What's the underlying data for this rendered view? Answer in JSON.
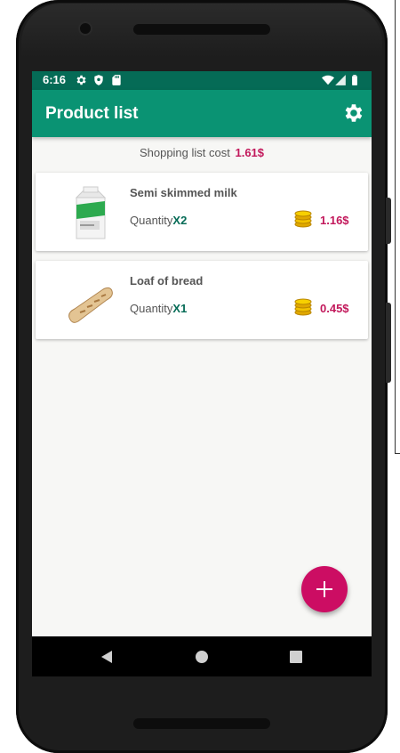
{
  "status_bar": {
    "time": "6:16",
    "left_icons": [
      "gear-icon",
      "shield-icon",
      "sd-card-icon"
    ],
    "right_icons": [
      "wifi-icon",
      "signal-icon",
      "battery-icon"
    ]
  },
  "app_bar": {
    "title": "Product list",
    "action_icon": "settings-icon"
  },
  "summary": {
    "label": "Shopping list cost",
    "value": "1.61$"
  },
  "products": [
    {
      "name": "Semi skimmed milk",
      "quantity_label": "Quantity",
      "quantity_value": "X2",
      "price": "1.16$",
      "image_icon": "milk-carton-icon"
    },
    {
      "name": "Loaf of bread",
      "quantity_label": "Quantity",
      "quantity_value": "X1",
      "price": "0.45$",
      "image_icon": "bread-icon"
    }
  ],
  "fab": {
    "icon": "plus-icon"
  },
  "nav_bar": {
    "buttons": [
      "back-icon",
      "home-icon",
      "recents-icon"
    ]
  },
  "colors": {
    "status_bar": "#056b56",
    "app_bar": "#0a9373",
    "accent": "#c2185b",
    "fab": "#cc0d63",
    "quantity": "#056b56"
  }
}
